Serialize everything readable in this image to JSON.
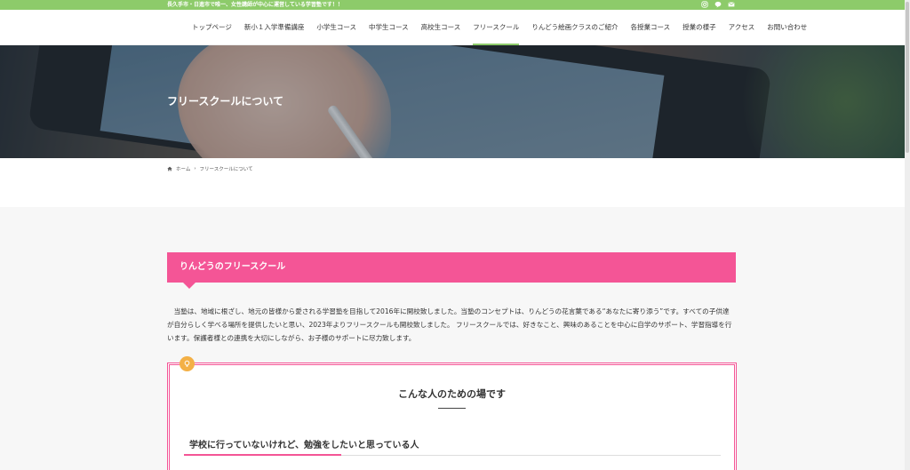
{
  "topbar": {
    "tagline": "長久手市・日進市で唯一、女性講師が中心に運営している学習塾です！！",
    "icons": [
      "instagram-icon",
      "line-icon",
      "mail-icon"
    ]
  },
  "nav": {
    "items": [
      {
        "label": "トップページ"
      },
      {
        "label": "新小１入学準備講座"
      },
      {
        "label": "小学生コース"
      },
      {
        "label": "中学生コース"
      },
      {
        "label": "高校生コース"
      },
      {
        "label": "フリースクール",
        "active": true
      },
      {
        "label": "りんどう絵画クラスのご紹介"
      },
      {
        "label": "各授業コース"
      },
      {
        "label": "授業の様子"
      },
      {
        "label": "アクセス"
      },
      {
        "label": "お問い合わせ"
      }
    ]
  },
  "hero": {
    "title": "フリースクールについて"
  },
  "breadcrumb": {
    "home": "ホーム",
    "separator": "›",
    "current": "フリースクールについて"
  },
  "section": {
    "heading": "りんどうのフリースクール",
    "paragraph": "　当塾は、地域に根ざし、地元の皆様から愛される学習塾を目指して2016年に開校致しました。当塾のコンセプトは、りんどうの花言葉である“あなたに寄り添う”です。すべての子供達が自分らしく学べる場所を提供したいと思い、2023年よりフリースクールも開校致しました。 フリースクールでは、好きなこと、興味のあることを中心に自学のサポート、学習指導を行います。保護者様との連携を大切にしながら、お子様のサポートに尽力致します。"
  },
  "box": {
    "icon": "lightbulb-icon",
    "title": "こんな人のための場です",
    "subheading": "学校に行っていないけれど、勉強をしたいと思っている人"
  },
  "colors": {
    "accent_green": "#8dcb6a",
    "accent_pink": "#f45596",
    "bulb_orange": "#f3b046"
  }
}
